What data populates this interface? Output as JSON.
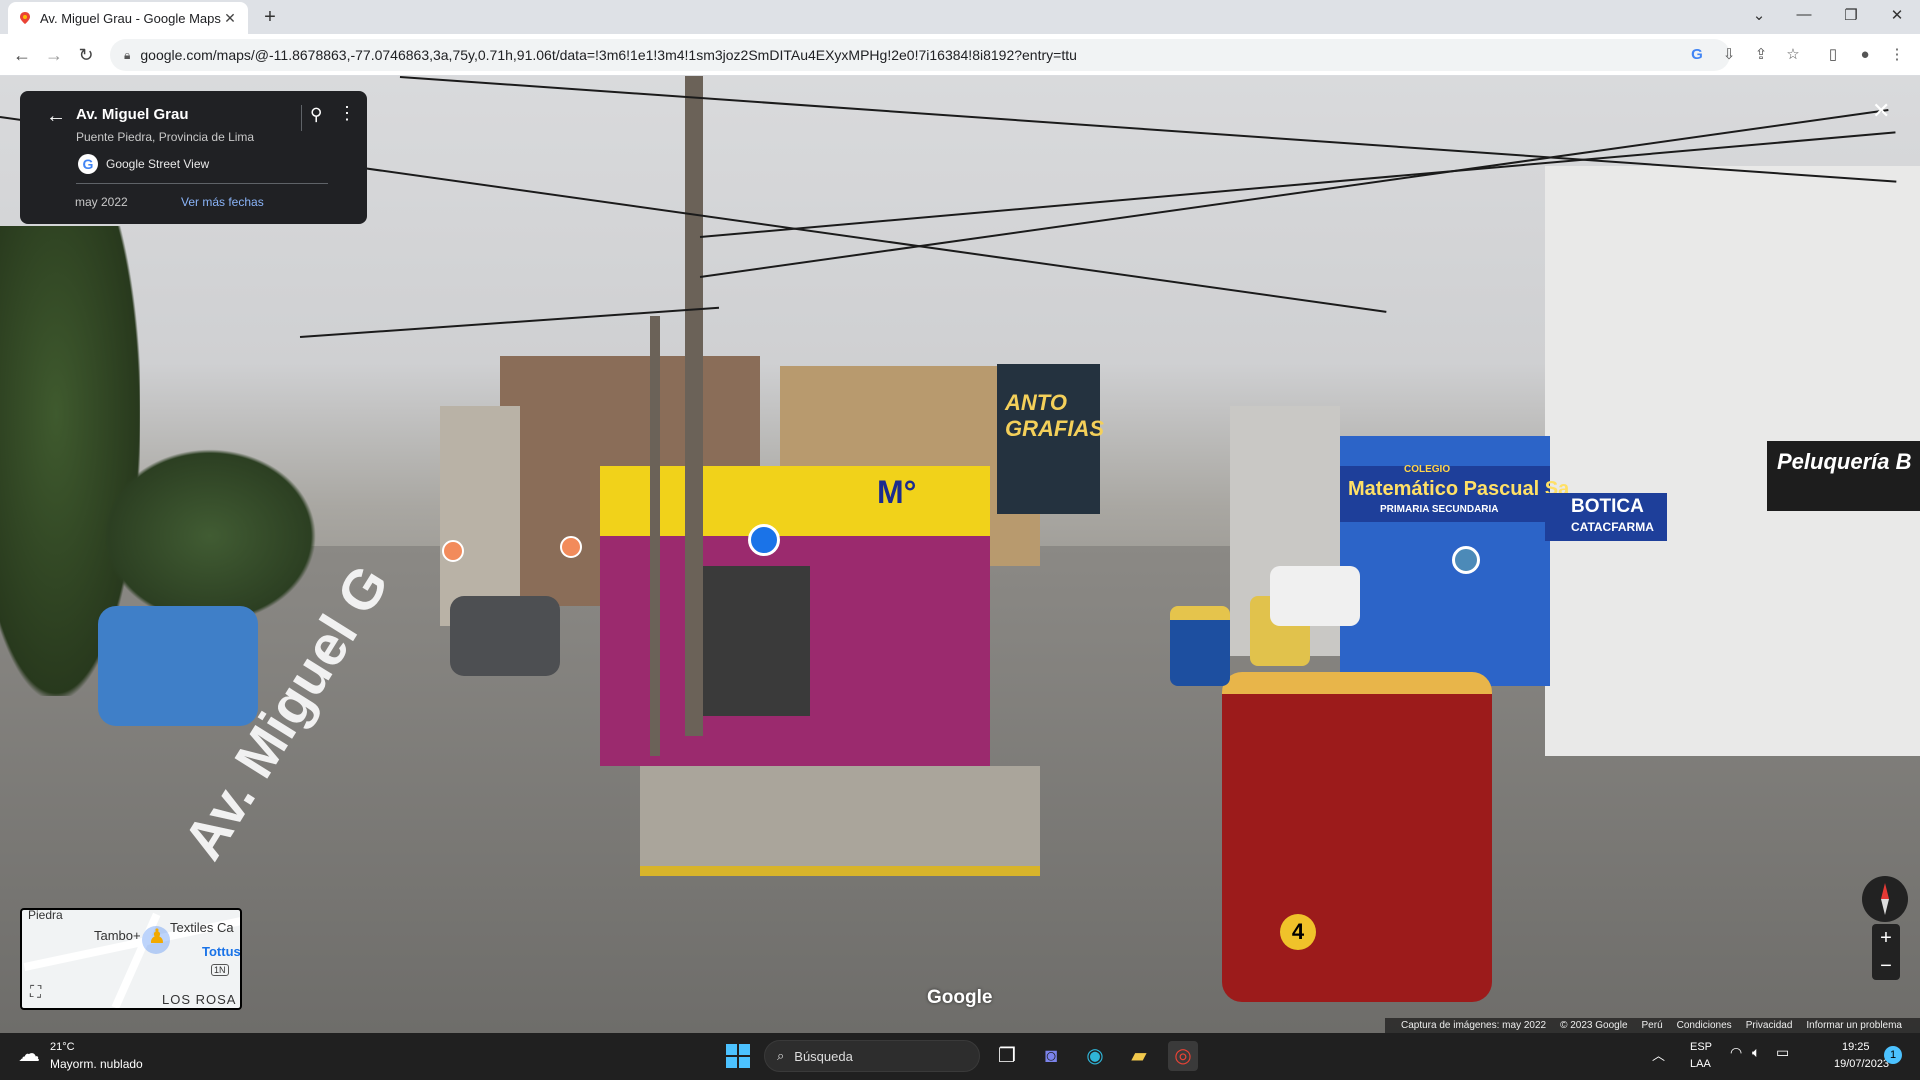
{
  "browser": {
    "tab_title": "Av. Miguel Grau - Google Maps",
    "new_tab": "+",
    "url": "google.com/maps/@-11.8678863,-77.0746863,3a,75y,0.71h,91.06t/data=!3m6!1e1!3m4!1sm3joz2SmDITAu4EXyxMPHg!2e0!7i16384!8i8192?entry=ttu",
    "window_controls": [
      "⌄",
      "—",
      "❐",
      "✕"
    ]
  },
  "info_card": {
    "place": "Av. Miguel Grau",
    "subtitle": "Puente Piedra, Provincia de Lima",
    "source": "Google Street View",
    "date": "may 2022",
    "more_dates": "Ver más fechas"
  },
  "scene_signs": {
    "photo": "ANTO GRAFIAS",
    "school": "Matemático Pascual Sa",
    "school_top": "COLEGIO",
    "school_bottom": "PRIMARIA    SECUNDARIA",
    "pharmacy": "BOTICA",
    "pharmacy_sub": "CATACFARMA",
    "salon": "Peluquería B",
    "store": "M°",
    "street": "Av. Miguel G",
    "mototaxi_number": "4"
  },
  "minimap": {
    "labels": [
      "Piedra",
      "Tambo+",
      "Textiles Ca",
      "Tottus",
      "1N",
      "LOS ROSA"
    ]
  },
  "watermark": "Google",
  "footer": [
    "Captura de imágenes: may 2022",
    "© 2023 Google",
    "Perú",
    "Condiciones",
    "Privacidad",
    "Informar un problema"
  ],
  "taskbar": {
    "temperature": "21°C",
    "condition": "Mayorm. nublado",
    "search_placeholder": "Búsqueda",
    "lang_top": "ESP",
    "lang_bottom": "LAA",
    "time": "19:25",
    "date": "19/07/2023",
    "notifications": "1"
  },
  "colors": {
    "store_yellow": "#f1d21a",
    "store_purple": "#9b2a6e",
    "school_blue": "#2c64c8",
    "mototaxi_red": "#9c1b1b",
    "chrome_accent": "#1a73e8"
  }
}
